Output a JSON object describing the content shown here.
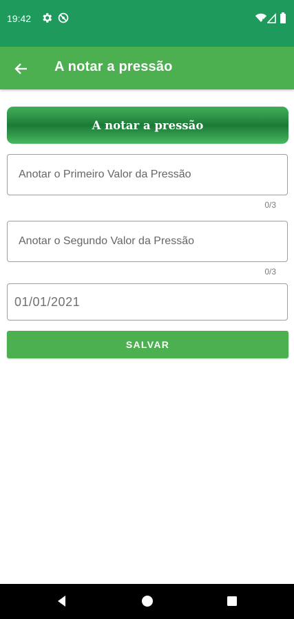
{
  "status_bar": {
    "time": "19:42",
    "icons": [
      "settings-icon",
      "do-not-disturb-icon",
      "wifi-icon",
      "signal-icon",
      "battery-icon"
    ],
    "background": "#1f9a5d"
  },
  "app_bar": {
    "title": "A notar a pressão",
    "back_icon": "arrow-back-icon",
    "background": "#4caf50"
  },
  "banner": {
    "text": "A notar a pressão"
  },
  "form": {
    "first_value": {
      "placeholder": "Anotar o Primeiro Valor da Pressão",
      "value": "",
      "counter": "0/3"
    },
    "second_value": {
      "placeholder": "Anotar o Segundo Valor da Pressão",
      "value": "",
      "counter": "0/3"
    },
    "date": {
      "value": "01/01/2021"
    },
    "save_label": "SALVAR"
  },
  "nav_bar": {
    "buttons": [
      "back-triangle-icon",
      "home-circle-icon",
      "recents-square-icon"
    ]
  },
  "colors": {
    "accent": "#4caf50",
    "status": "#1f9a5d"
  }
}
